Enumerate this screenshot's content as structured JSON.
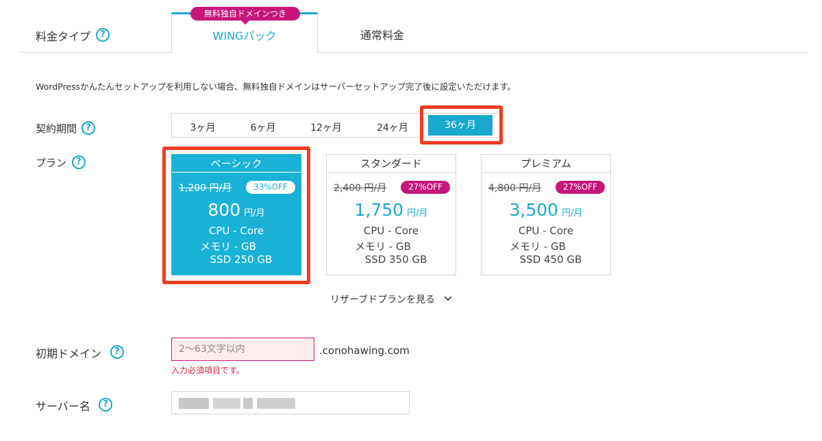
{
  "tabs": {
    "label": "料金タイプ",
    "badge": "無料独自ドメインつき",
    "wing": "WINGパック",
    "normal": "通常料金"
  },
  "notice": "WordPressかんたんセットアップを利用しない場合、無料独自ドメインはサーバーセットアップ完了後に設定いただけます。",
  "period": {
    "label": "契約期間",
    "options": [
      "3ヶ月",
      "6ヶ月",
      "12ヶ月",
      "24ヶ月",
      "36ヶ月"
    ],
    "selected": "36ヶ月"
  },
  "plan": {
    "label": "プラン",
    "cards": [
      {
        "name": "ベーシック",
        "old_price": "1,200 円/月",
        "off": "33%OFF",
        "price": "800",
        "unit": "円/月",
        "cpu": "CPU - Core",
        "memory": "メモリ - GB",
        "ssd": "SSD 250 GB",
        "selected": true
      },
      {
        "name": "スタンダード",
        "old_price": "2,400 円/月",
        "off": "27%OFF",
        "price": "1,750",
        "unit": "円/月",
        "cpu": "CPU - Core",
        "memory": "メモリ - GB",
        "ssd": "SSD 350 GB",
        "selected": false
      },
      {
        "name": "プレミアム",
        "old_price": "4,800 円/月",
        "off": "27%OFF",
        "price": "3,500",
        "unit": "円/月",
        "cpu": "CPU - Core",
        "memory": "メモリ - GB",
        "ssd": "SSD 450 GB",
        "selected": false
      }
    ],
    "reserve_link": "リザーブドプランを見る"
  },
  "domain": {
    "label": "初期ドメイン",
    "placeholder": "2〜63文字以内",
    "suffix": ".conohawing.com",
    "error": "入力必須項目です。"
  },
  "server": {
    "label": "サーバー名"
  },
  "help_glyph": "?",
  "colors": {
    "accent": "#1aa8cf",
    "badge": "#c7167a",
    "highlight": "#f03c1e"
  }
}
